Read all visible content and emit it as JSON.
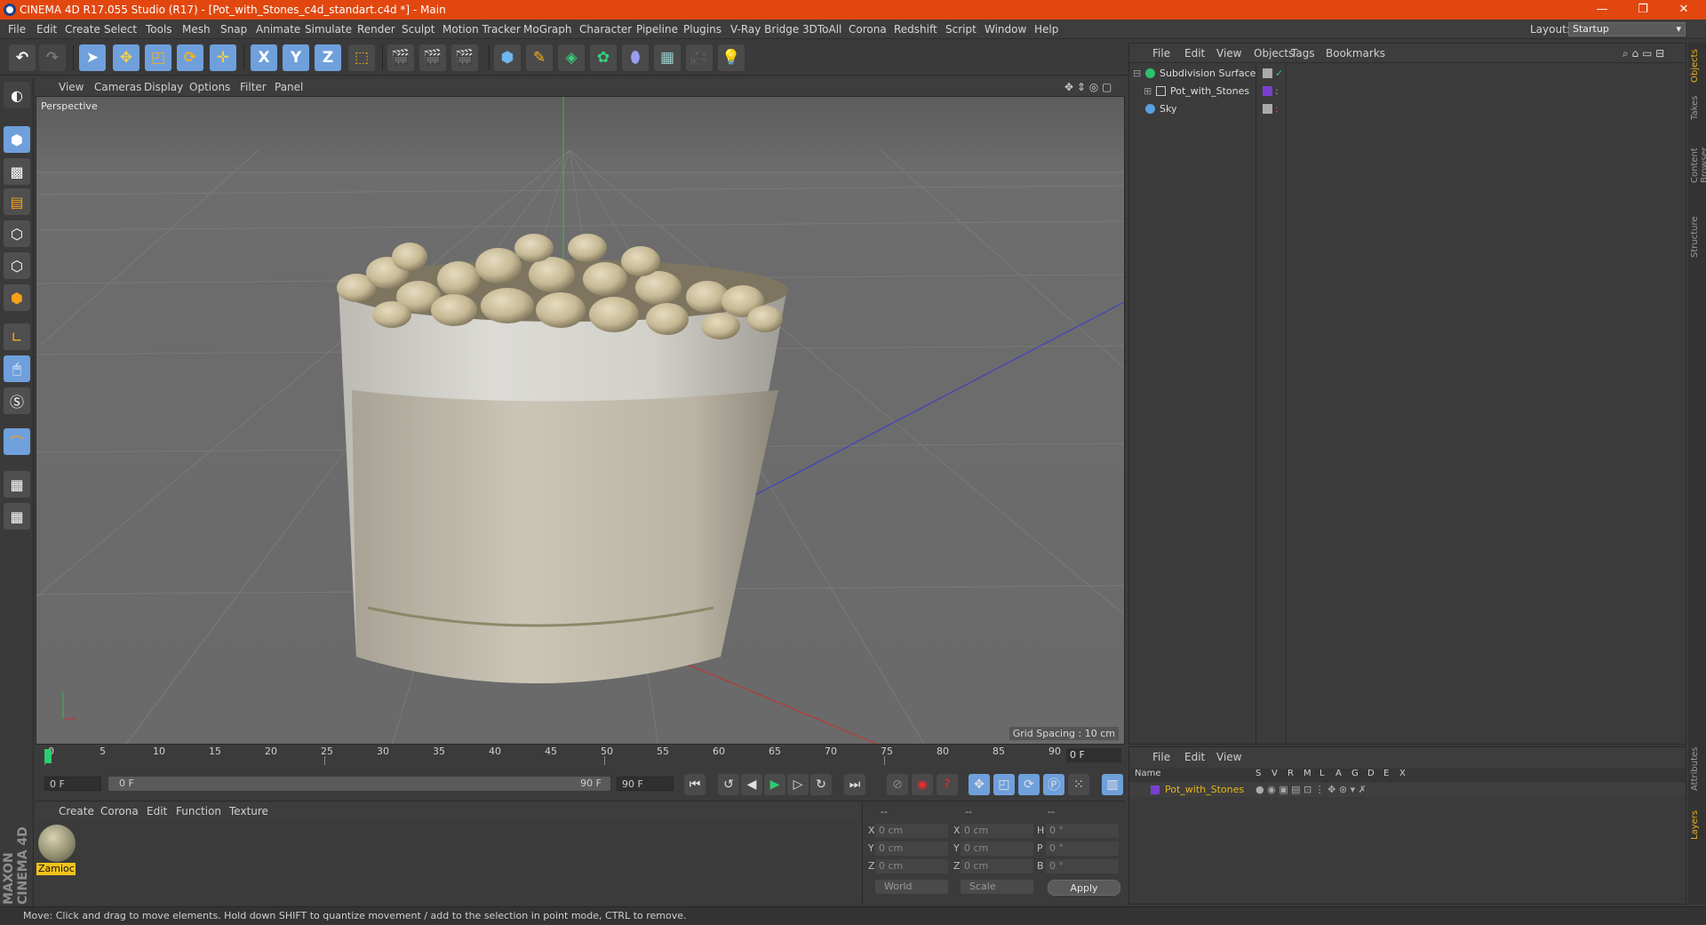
{
  "window": {
    "title": "CINEMA 4D R17.055 Studio (R17) - [Pot_with_Stones_c4d_standart.c4d *] - Main",
    "minimize": "—",
    "restore": "❐",
    "close": "✕"
  },
  "menubar": {
    "items": [
      "File",
      "Edit",
      "Create",
      "Select",
      "Tools",
      "Mesh",
      "Snap",
      "Animate",
      "Simulate",
      "Render",
      "Sculpt",
      "Motion Tracker",
      "MoGraph",
      "Character",
      "Pipeline",
      "Plugins",
      "V-Ray Bridge",
      "3DToAll",
      "Corona",
      "Redshift",
      "Script",
      "Window",
      "Help"
    ],
    "layout_label": "Layout:",
    "layout_value": "Startup"
  },
  "toolbar": {
    "axis_x": "X",
    "axis_y": "Y",
    "axis_z": "Z"
  },
  "viewport": {
    "menu": [
      "View",
      "Cameras",
      "Display",
      "Options",
      "Filter",
      "Panel"
    ],
    "label": "Perspective",
    "grid_spacing": "Grid Spacing : 10 cm"
  },
  "timeline": {
    "ticks": [
      "0",
      "5",
      "10",
      "15",
      "20",
      "25",
      "30",
      "35",
      "40",
      "45",
      "50",
      "55",
      "60",
      "65",
      "70",
      "75",
      "80",
      "85",
      "90"
    ],
    "current_frame": "0 F",
    "start_field": "0 F",
    "range_start": "0 F",
    "range_end": "90 F",
    "end_field": "90 F"
  },
  "material_manager": {
    "menu": [
      "Create",
      "Corona",
      "Edit",
      "Function",
      "Texture"
    ],
    "material_name": "Zamioc"
  },
  "coordinates": {
    "header": [
      "--",
      "--",
      "--"
    ],
    "rows": [
      {
        "a": "X",
        "av": "0 cm",
        "b": "X",
        "bv": "0 cm",
        "c": "H",
        "cv": "0 °"
      },
      {
        "a": "Y",
        "av": "0 cm",
        "b": "Y",
        "bv": "0 cm",
        "c": "P",
        "cv": "0 °"
      },
      {
        "a": "Z",
        "av": "0 cm",
        "b": "Z",
        "bv": "0 cm",
        "c": "B",
        "cv": "0 °"
      }
    ],
    "mode": "World",
    "scale": "Scale",
    "apply": "Apply"
  },
  "object_manager": {
    "menu": [
      "File",
      "Edit",
      "View",
      "Objects",
      "Tags",
      "Bookmarks"
    ],
    "objects": [
      {
        "name": "Subdivision Surface",
        "color": "#2fbf6b"
      },
      {
        "name": "Pot_with_Stones",
        "color": "#c8c8c8"
      },
      {
        "name": "Sky",
        "color": "#5aa0e0"
      }
    ]
  },
  "layer_manager": {
    "menu": [
      "File",
      "Edit",
      "View"
    ],
    "columns": [
      "Name",
      "S",
      "V",
      "R",
      "M",
      "L",
      "A",
      "G",
      "D",
      "E",
      "X"
    ],
    "layer_name": "Pot_with_Stones",
    "layer_color": "#7a3fd0"
  },
  "right_tabs": [
    "Objects",
    "Takes",
    "Content Browser",
    "Structure",
    "Attributes",
    "Layers"
  ],
  "branding": "MAXON CINEMA 4D",
  "status": "Move: Click and drag to move elements. Hold down SHIFT to quantize movement / add to the selection in point mode, CTRL to remove.",
  "colors": {
    "titlebar": "#e2470f",
    "accent_blue": "#6fa0dc",
    "selection_yellow": "#f2c21b"
  }
}
